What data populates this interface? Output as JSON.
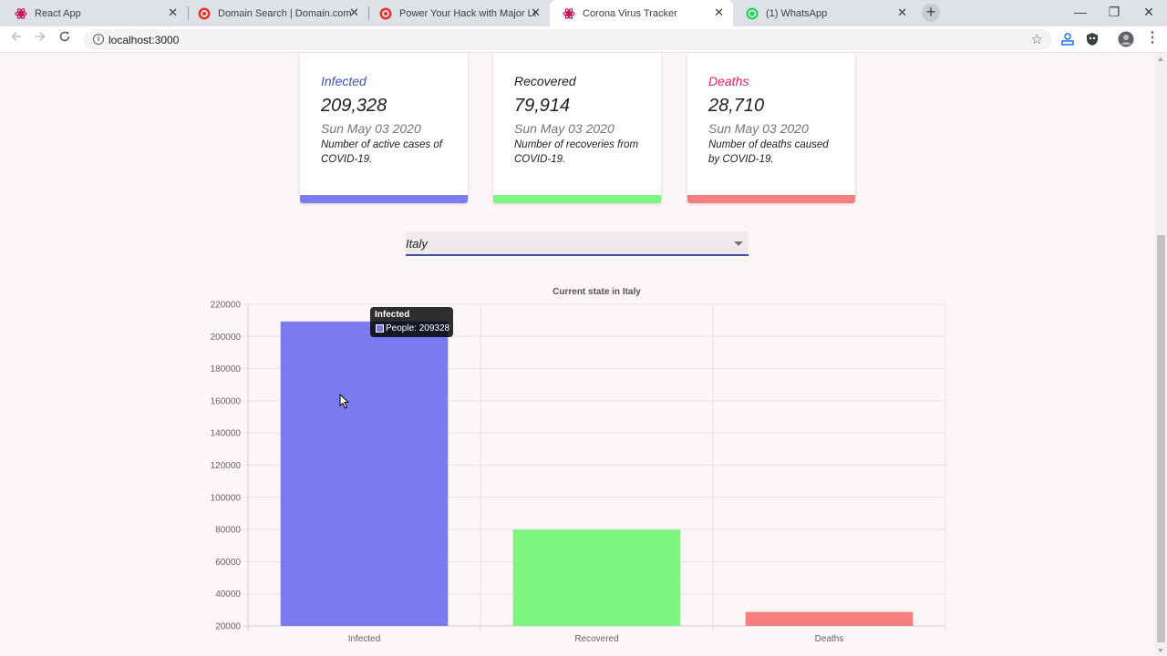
{
  "browser": {
    "tabs": [
      {
        "title": "React App",
        "active": false,
        "icon": "react-icon"
      },
      {
        "title": "Domain Search | Domain.com",
        "active": false,
        "icon": "domain-icon"
      },
      {
        "title": "Power Your Hack with Major Leag",
        "active": false,
        "icon": "mlh-icon"
      },
      {
        "title": "Corona Virus Tracker",
        "active": true,
        "icon": "react-icon"
      },
      {
        "title": "(1) WhatsApp",
        "active": false,
        "icon": "whatsapp-icon"
      }
    ],
    "url": "localhost:3000",
    "close_glyph": "✕",
    "new_tab_glyph": "+",
    "minimize_glyph": "—",
    "restore_glyph": "❐",
    "close_window_glyph": "✕"
  },
  "cards": [
    {
      "title": "Infected",
      "value": "209,328",
      "date": "Sun May 03 2020",
      "description": "Number of active cases of COVID-19.",
      "title_color": "#3f51b5",
      "bar_color": "#7b7bef"
    },
    {
      "title": "Recovered",
      "value": "79,914",
      "date": "Sun May 03 2020",
      "description": "Number of recoveries from COVID-19.",
      "title_color": "#212121",
      "bar_color": "#7ef57e"
    },
    {
      "title": "Deaths",
      "value": "28,710",
      "date": "Sun May 03 2020",
      "description": "Number of deaths caused by COVID-19.",
      "title_color": "#e91e63",
      "bar_color": "#f77f7f"
    }
  ],
  "country_select": {
    "value": "Italy"
  },
  "tooltip": {
    "title": "Infected",
    "body": "People: 209328"
  },
  "chart_data": {
    "type": "bar",
    "title": "Current state in Italy",
    "categories": [
      "Infected",
      "Recovered",
      "Deaths"
    ],
    "values": [
      209328,
      79914,
      28710
    ],
    "colors": [
      "#7b7bef",
      "#7ef57e",
      "#f77f7f"
    ],
    "ylim": [
      20000,
      220000
    ],
    "yticks": [
      20000,
      40000,
      60000,
      80000,
      100000,
      120000,
      140000,
      160000,
      180000,
      200000,
      220000
    ],
    "grid": true,
    "legend": "none"
  }
}
